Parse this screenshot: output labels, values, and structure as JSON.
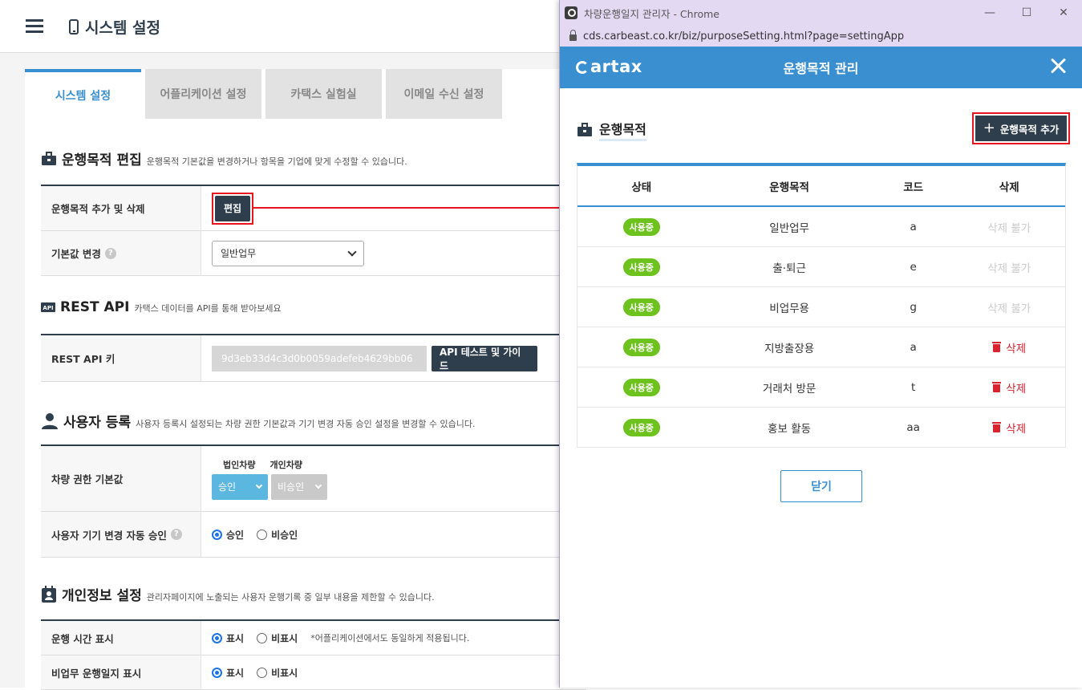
{
  "header": {
    "title": "시스템 설정"
  },
  "tabs": [
    {
      "label": "시스템 설정"
    },
    {
      "label": "어플리케이션 설정"
    },
    {
      "label": "카택스 실험실"
    },
    {
      "label": "이메일 수신 설정"
    }
  ],
  "purpose": {
    "title": "운행목적 편집",
    "desc": "운행목적 기본값을 변경하거나 항목을 기업에 맞게 수정할 수 있습니다.",
    "row1_label": "운행목적 추가 및 삭제",
    "edit_label": "편집",
    "row2_label": "기본값 변경",
    "default_value": "일반업무"
  },
  "rest": {
    "title": "REST API",
    "desc": "카택스 데이터를 API를 통해 받아보세요",
    "row_label": "REST API 키",
    "key": "9d3eb33d4c3d0b0059adefeb4629bb06",
    "test_label": "API 테스트 및 가이드"
  },
  "user": {
    "title": "사용자 등록",
    "desc": "사용자 등록시 설정되는 차량 권한 기본값과 기기 변경 자동 승인 설정을 변경할 수 있습니다.",
    "row1_label": "차량 권한 기본값",
    "corp_label": "법인차량",
    "personal_label": "개인차량",
    "corp_value": "승인",
    "personal_value": "비승인",
    "row2_label": "사용자 기기 변경 자동 승인",
    "approve": "승인",
    "reject": "비승인"
  },
  "privacy": {
    "title": "개인정보 설정",
    "desc": "관리자페이지에 노출되는 사용자 운행기록 중 일부 내용을 제한할 수 있습니다.",
    "row1_label": "운행 시간 표시",
    "row2_label": "비업무 운행일지 표시",
    "show": "표시",
    "hide": "비표시",
    "note": "*어플리케이션에서도 동일하게 적용됩니다."
  },
  "popup": {
    "window_title": "차량운행일지 관리자 - Chrome",
    "url": "cds.carbeast.co.kr/biz/purposeSetting.html?page=settingApp",
    "logo": "cartax",
    "modal_title": "운행목적 관리",
    "section_title": "운행목적",
    "add_label": "운행목적 추가",
    "close_label": "닫기",
    "columns": [
      "상태",
      "운행목적",
      "코드",
      "삭제"
    ],
    "rows": [
      {
        "status": "사용중",
        "purpose": "일반업무",
        "code": "a",
        "delete": "삭제 불가",
        "deletable": false
      },
      {
        "status": "사용중",
        "purpose": "출·퇴근",
        "code": "e",
        "delete": "삭제 불가",
        "deletable": false
      },
      {
        "status": "사용중",
        "purpose": "비업무용",
        "code": "g",
        "delete": "삭제 불가",
        "deletable": false
      },
      {
        "status": "사용중",
        "purpose": "지방출장용",
        "code": "a",
        "delete": "삭제",
        "deletable": true
      },
      {
        "status": "사용중",
        "purpose": "거래처 방문",
        "code": "t",
        "delete": "삭제",
        "deletable": true
      },
      {
        "status": "사용중",
        "purpose": "홍보 활동",
        "code": "aa",
        "delete": "삭제",
        "deletable": true
      }
    ]
  },
  "colors": {
    "accent": "#3a8fd0",
    "dark": "#2f3e4d",
    "badge": "#6ec21e",
    "danger": "#d9232e",
    "highlight": "#e8141e"
  }
}
